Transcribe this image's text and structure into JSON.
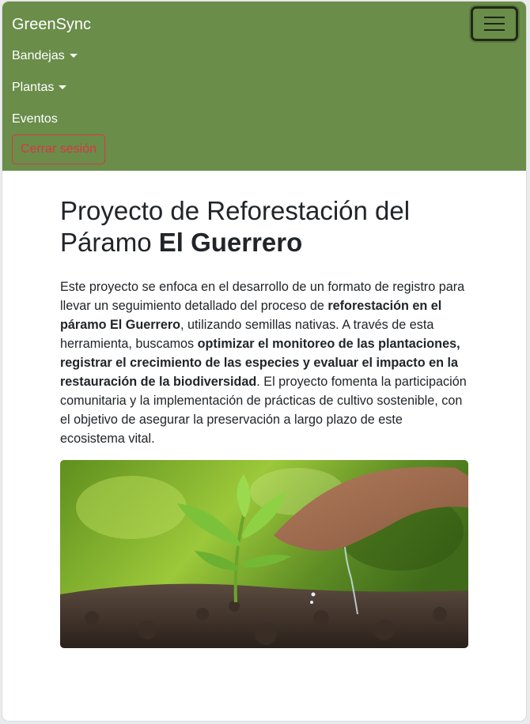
{
  "navbar": {
    "brand": "GreenSync",
    "items": [
      {
        "label": "Bandejas",
        "dropdown": true
      },
      {
        "label": "Plantas",
        "dropdown": true
      },
      {
        "label": "Eventos",
        "dropdown": false
      }
    ],
    "logout_label": "Cerrar sesión",
    "toggler_icon": "hamburger-menu-icon",
    "bg_color": "#6a8d4a"
  },
  "main": {
    "title_plain": "Proyecto de Reforestación del Páramo ",
    "title_bold": "El Guerrero",
    "description": [
      {
        "text": "Este proyecto se enfoca en el desarrollo de un formato de registro para llevar un seguimiento detallado del proceso de ",
        "bold": false
      },
      {
        "text": "reforestación en el páramo El Guerrero",
        "bold": true
      },
      {
        "text": ", utilizando semillas nativas. A través de esta herramienta, buscamos ",
        "bold": false
      },
      {
        "text": "optimizar el monitoreo de las plantaciones, registrar el crecimiento de las especies y evaluar el impacto en la restauración de la biodiversidad",
        "bold": true
      },
      {
        "text": ". El proyecto fomenta la participación comunitaria y la implementación de prácticas de cultivo sostenible, con el objetivo de asegurar la preservación a largo plazo de este ecosistema vital.",
        "bold": false
      }
    ]
  }
}
